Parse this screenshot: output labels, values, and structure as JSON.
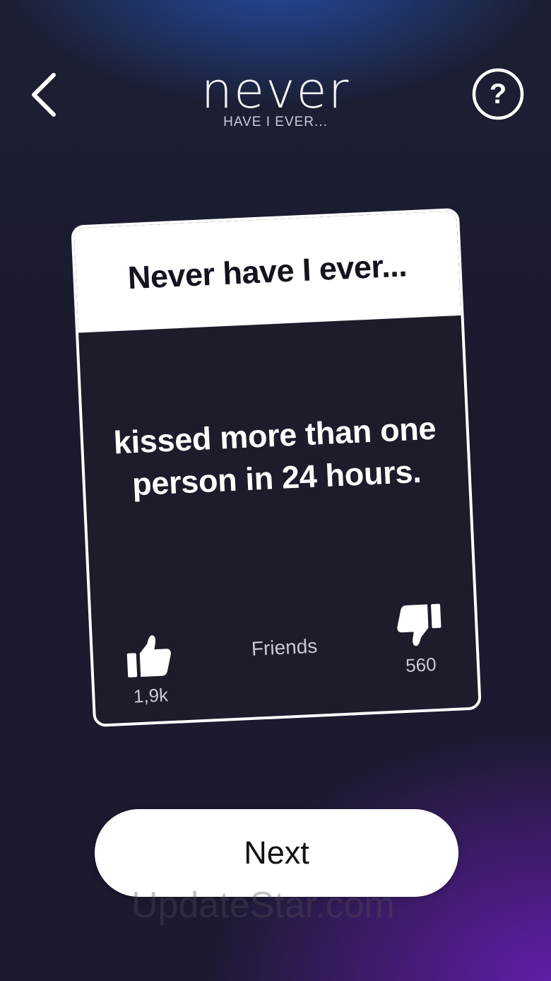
{
  "header": {
    "back_icon": "chevron-left-icon",
    "logo_main": "never",
    "logo_sub": "HAVE I EVER...",
    "help_icon": "question-circle-icon"
  },
  "card": {
    "title": "Never have I ever...",
    "statement": "kissed more than one person in 24 hours.",
    "category": "Friends",
    "like_icon": "thumbs-up-icon",
    "like_count": "1,9k",
    "dislike_icon": "thumbs-down-icon",
    "dislike_count": "560"
  },
  "footer": {
    "next_label": "Next",
    "watermark": "UpdateStar.com"
  },
  "colors": {
    "background": "#1c1c2e",
    "card_header": "#ffffff",
    "card_body": "#1d1c2b",
    "accent_purple": "#6e1ebe",
    "accent_blue": "#285ac8"
  }
}
